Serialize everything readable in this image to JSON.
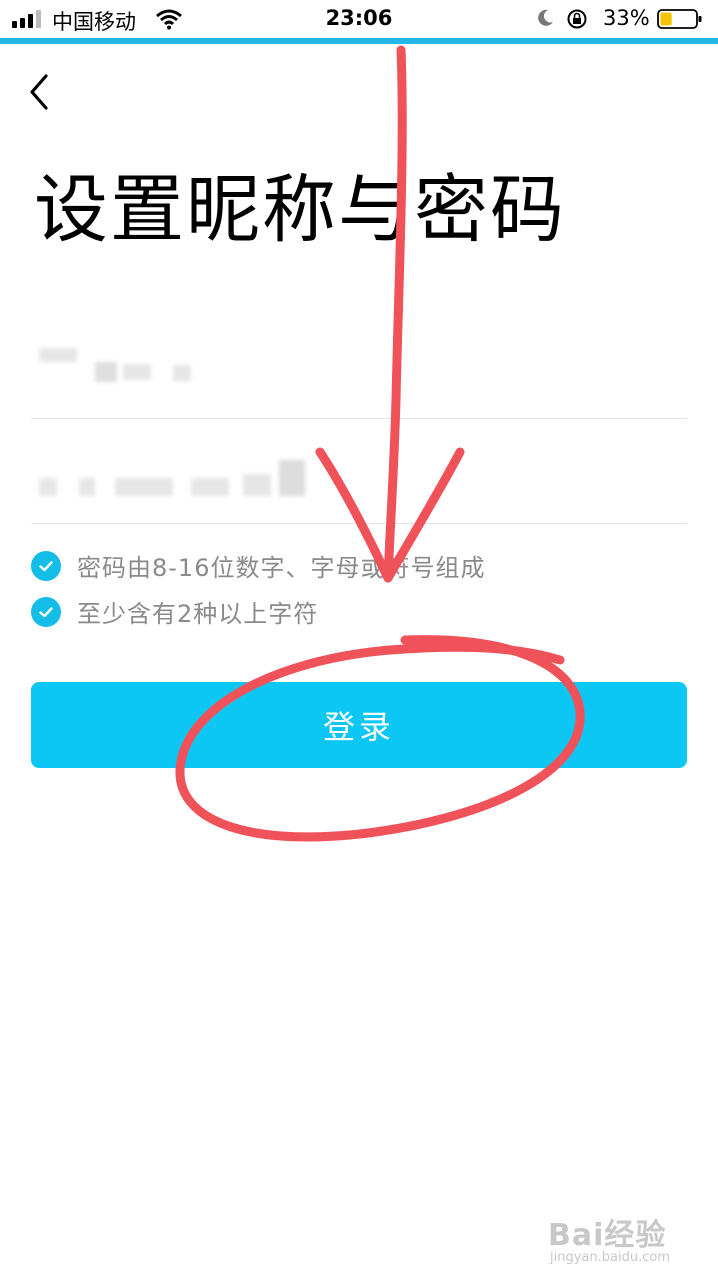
{
  "status_bar": {
    "carrier": "中国移动",
    "time": "23:06",
    "battery_percent": "33%",
    "battery_level": 0.33,
    "icons": [
      "signal-icon",
      "wifi-icon",
      "moon-icon",
      "orientation-lock-icon",
      "battery-icon"
    ]
  },
  "colors": {
    "accent": "#22b7e8",
    "button": "#0cc7f3",
    "check": "#13bde8",
    "annotation": "#f0525a",
    "battery_fill": "#f5c400"
  },
  "header": {
    "back_icon": "chevron-left-icon",
    "title": "设置昵称与密码"
  },
  "form": {
    "nickname_blurred": true,
    "password_blurred": true
  },
  "rules": [
    {
      "text": "密码由8-16位数字、字母或符号组成",
      "checked": true
    },
    {
      "text": "至少含有2种以上字符",
      "checked": true
    }
  ],
  "login_button": {
    "label": "登录"
  },
  "watermark": {
    "brand": "Bai经验",
    "url": "jingyan.baidu.com"
  }
}
